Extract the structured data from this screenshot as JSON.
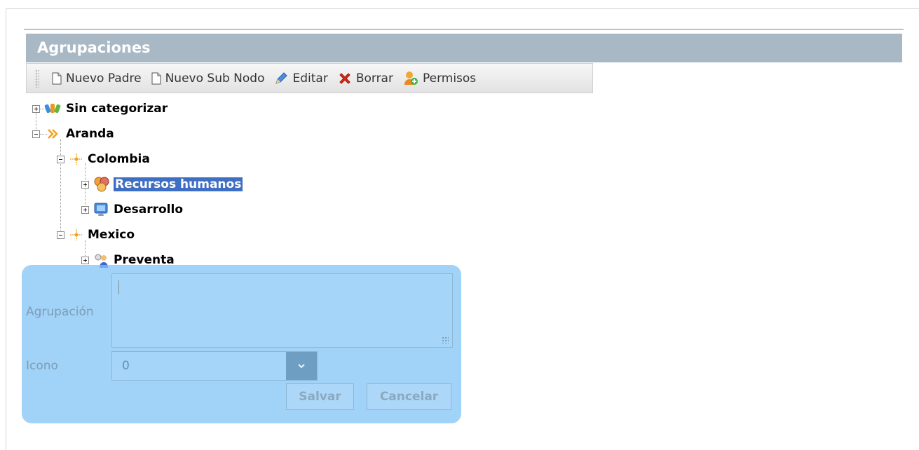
{
  "panel": {
    "title": "Agrupaciones"
  },
  "toolbar": {
    "new_parent": "Nuevo Padre",
    "new_subnode": "Nuevo Sub Nodo",
    "edit": "Editar",
    "delete": "Borrar",
    "permissions": "Permisos"
  },
  "tree": {
    "sin_categorizar": "Sin categorizar",
    "aranda": "Aranda",
    "colombia": "Colombia",
    "recursos_humanos": "Recursos humanos",
    "desarrollo": "Desarrollo",
    "mexico": "Mexico",
    "preventa": "Preventa"
  },
  "form": {
    "agrupacion_label": "Agrupación",
    "agrupacion_value": "",
    "icono_label": "Icono",
    "icono_value": "0",
    "save": "Salvar",
    "cancel": "Cancelar"
  },
  "colors": {
    "header_bg": "#a8b8c5",
    "selection": "#3f6fc5",
    "overlay": "#82c3f5"
  }
}
